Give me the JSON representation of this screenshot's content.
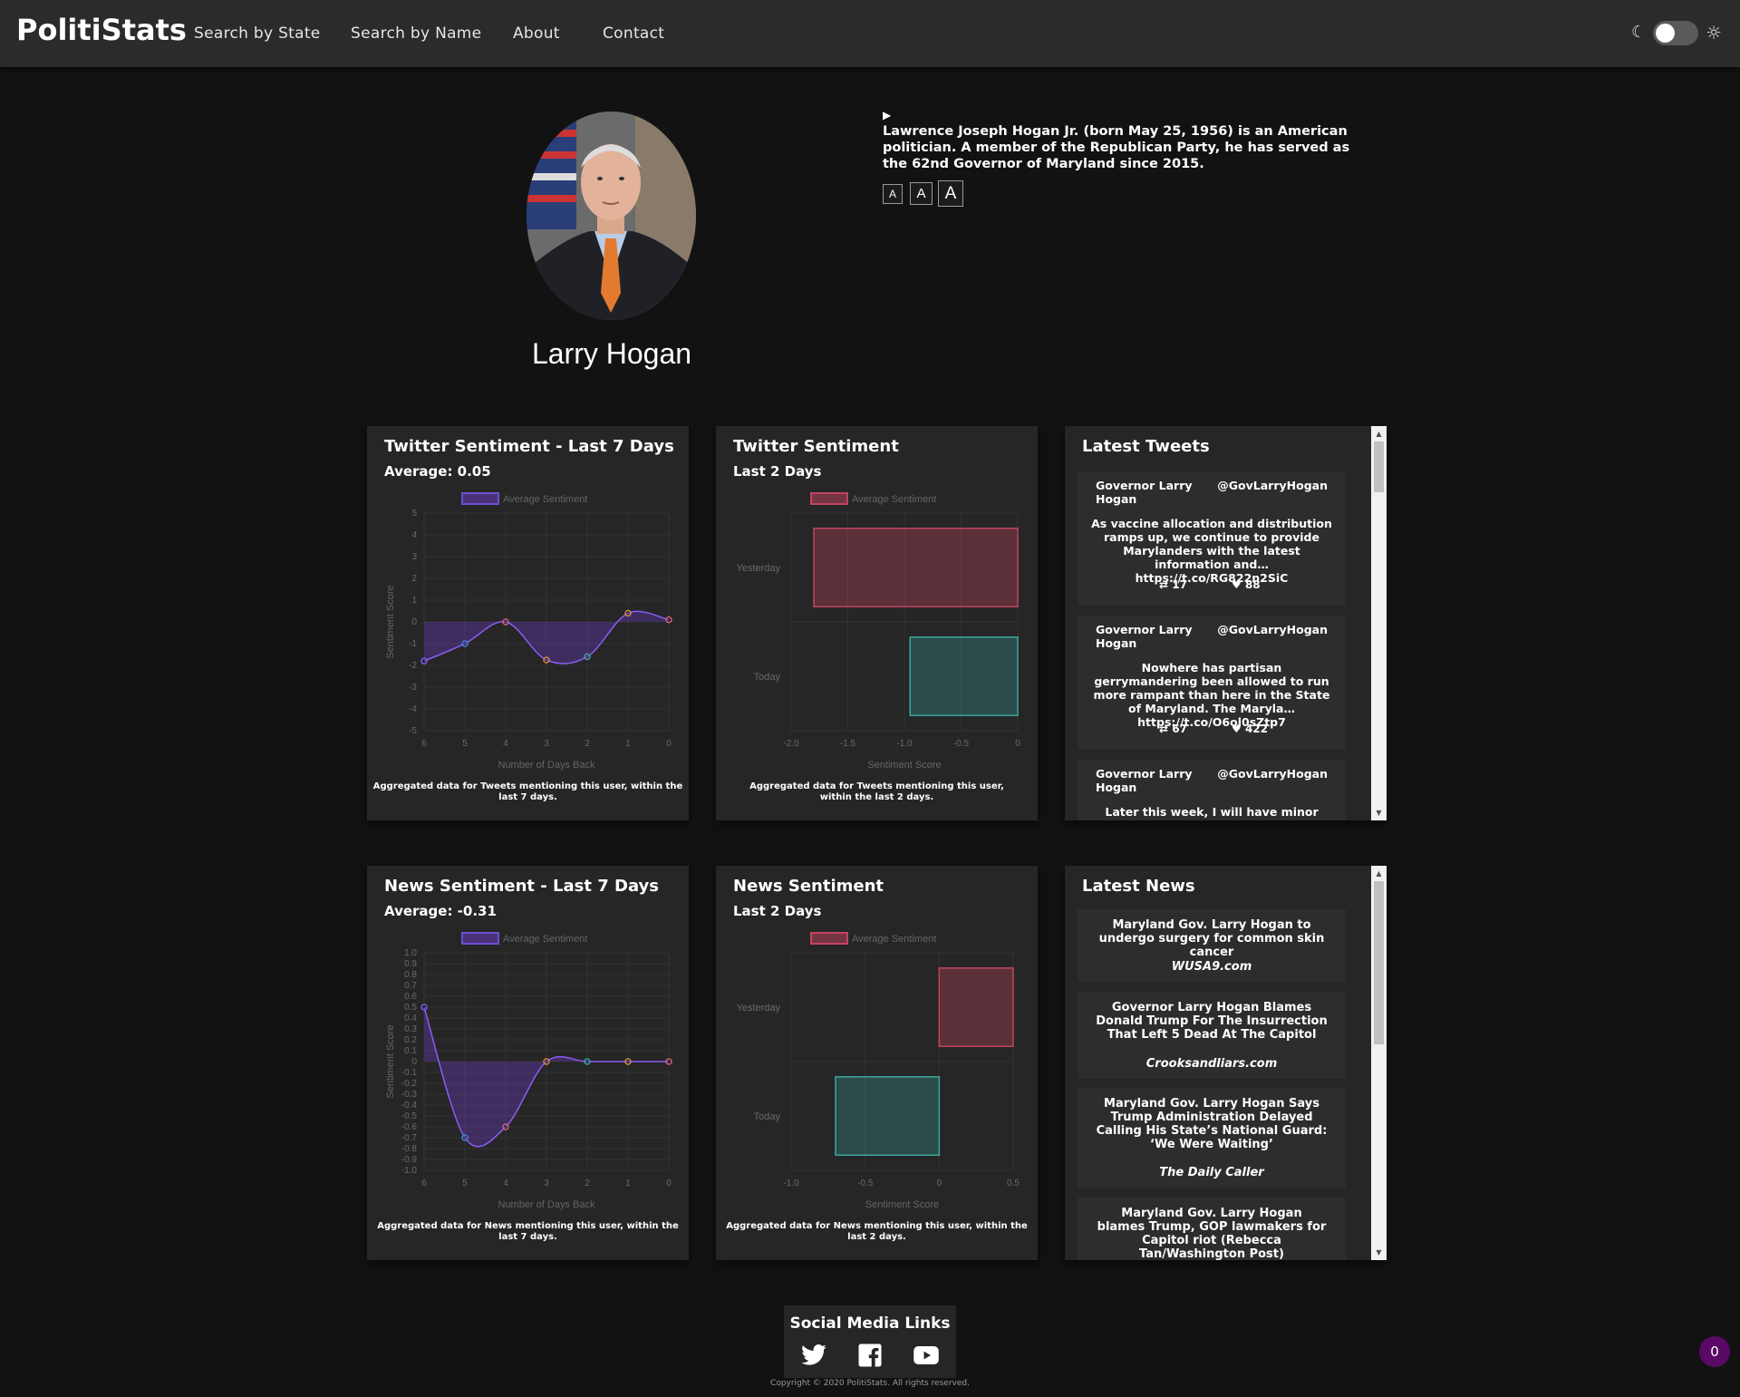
{
  "nav": {
    "brand": "PolitiStats",
    "links": [
      "Search by State",
      "Search by Name",
      "About",
      "Contact"
    ]
  },
  "profile": {
    "name": "Larry Hogan",
    "bio_toggle": "▶",
    "bio": "Lawrence Joseph Hogan Jr. (born May 25, 1956) is an American politician. A member of the Republican Party, he has served as the 62nd Governor of Maryland since 2015.",
    "font_buttons": [
      "A",
      "A",
      "A"
    ]
  },
  "twitter_week": {
    "title": "Twitter Sentiment - Last 7 Days",
    "average": "Average: 0.05",
    "caption": "Aggregated data for Tweets mentioning this user, within the last 7 days."
  },
  "twitter_2day": {
    "title": "Twitter Sentiment",
    "subtitle": "Last 2 Days",
    "caption": "Aggregated data for Tweets mentioning this user, within the last 2 days."
  },
  "news_week": {
    "title": "News Sentiment - Last 7 Days",
    "average": "Average: -0.31",
    "caption": "Aggregated data for News mentioning this user, within the last 7 days."
  },
  "news_2day": {
    "title": "News Sentiment",
    "subtitle": "Last 2 Days",
    "caption": "Aggregated data for News mentioning this user, within the last 2 days."
  },
  "tweets": {
    "title": "Latest Tweets",
    "items": [
      {
        "name": "Governor Larry Hogan",
        "handle": "@GovLarryHogan",
        "text": "As vaccine allocation and distribution ramps up, we continue to provide Marylanders with the latest information and… https://t.co/RG822n2SiC",
        "retweets": "17",
        "likes": "88"
      },
      {
        "name": "Governor Larry Hogan",
        "handle": "@GovLarryHogan",
        "text": "Nowhere has partisan gerrymandering been allowed to run more rampant than here in the State of Maryland. The Maryla… https://t.co/O6ol0sZtp7",
        "retweets": "67",
        "likes": "422"
      },
      {
        "name": "Governor Larry Hogan",
        "handle": "@GovLarryHogan",
        "text": "Later this week, I will have minor outpatient",
        "retweets": "",
        "likes": ""
      }
    ]
  },
  "news": {
    "title": "Latest News",
    "items": [
      {
        "title": "Maryland Gov. Larry Hogan to undergo surgery for common skin cancer",
        "source": "WUSA9.com"
      },
      {
        "title": "Governor Larry Hogan Blames Donald Trump For The Insurrection That Left 5 Dead At The Capitol",
        "source": "Crooksandliars.com"
      },
      {
        "title": "Maryland Gov. Larry Hogan Says Trump Administration Delayed Calling His State’s National Guard: ‘We Were Waiting’",
        "source": "The Daily Caller"
      },
      {
        "title": "Maryland Gov. Larry Hogan blames Trump, GOP lawmakers for Capitol riot (Rebecca Tan/Washington Post)",
        "source": ""
      }
    ]
  },
  "footer": {
    "social_title": "Social Media Links",
    "copyright": "Copyright © 2020 PolitiStats. All rights reserved.",
    "badge": "0"
  },
  "icons": {
    "moon": "moon-icon",
    "sun": "sun-icon",
    "retweet": "retweet-icon",
    "heart": "heart-icon",
    "twitter": "twitter-icon",
    "facebook": "facebook-icon",
    "youtube": "youtube-icon"
  },
  "colors": {
    "page_bg": "#121212",
    "navbar_bg": "#2b2b2b",
    "card_bg": "#262626",
    "line_series": "#8b5cf6",
    "bar_red": "#c1455f",
    "bar_teal": "#3aa7a0",
    "badge": "#5a0a66"
  },
  "chart_data": [
    {
      "type": "line",
      "title": "Twitter Sentiment - Last 7 Days",
      "xlabel": "Number of Days Back",
      "ylabel": "Sentiment Score",
      "x": [
        6,
        5,
        4,
        3,
        2,
        1,
        0
      ],
      "ylim": [
        -5,
        5
      ],
      "yticks": [
        5,
        4,
        3,
        2,
        1,
        0,
        -1,
        -2,
        -3,
        -4,
        -5
      ],
      "series": [
        {
          "name": "Average Sentiment",
          "values": [
            -1.8,
            -1.0,
            0.0,
            -1.75,
            -1.6,
            0.4,
            0.1
          ]
        }
      ],
      "legend": "top"
    },
    {
      "type": "bar",
      "orientation": "horizontal",
      "title": "Twitter Sentiment",
      "xlabel": "Sentiment Score",
      "categories": [
        "Yesterday",
        "Today"
      ],
      "xlim": [
        -2.0,
        0
      ],
      "xticks": [
        "-2.0",
        "-1.5",
        "-1.0",
        "-0.5",
        "0"
      ],
      "series": [
        {
          "name": "Average Sentiment",
          "values": [
            -1.8,
            -0.95
          ]
        }
      ],
      "legend": "top"
    },
    {
      "type": "line",
      "title": "News Sentiment - Last 7 Days",
      "xlabel": "Number of Days Back",
      "ylabel": "Sentiment Score",
      "x": [
        6,
        5,
        4,
        3,
        2,
        1,
        0
      ],
      "ylim": [
        -1.0,
        1.0
      ],
      "yticks": [
        "1.0",
        "0.9",
        "0.8",
        "0.7",
        "0.6",
        "0.5",
        "0.4",
        "0.3",
        "0.2",
        "0.1",
        "0",
        "-0.1",
        "-0.2",
        "-0.3",
        "-0.4",
        "-0.5",
        "-0.6",
        "-0.7",
        "-0.8",
        "-0.9",
        "-1.0"
      ],
      "series": [
        {
          "name": "Average Sentiment",
          "values": [
            0.5,
            -0.7,
            -0.6,
            0.0,
            0.0,
            0.0,
            0.0
          ]
        }
      ],
      "legend": "top"
    },
    {
      "type": "bar",
      "orientation": "horizontal",
      "title": "News Sentiment",
      "xlabel": "Sentiment Score",
      "categories": [
        "Yesterday",
        "Today"
      ],
      "xlim": [
        -1.0,
        0.5
      ],
      "xticks": [
        "-1.0",
        "-0.5",
        "0",
        "0.5"
      ],
      "series": [
        {
          "name": "Average Sentiment",
          "values": [
            0.5,
            -0.7
          ]
        }
      ],
      "legend": "top"
    }
  ]
}
